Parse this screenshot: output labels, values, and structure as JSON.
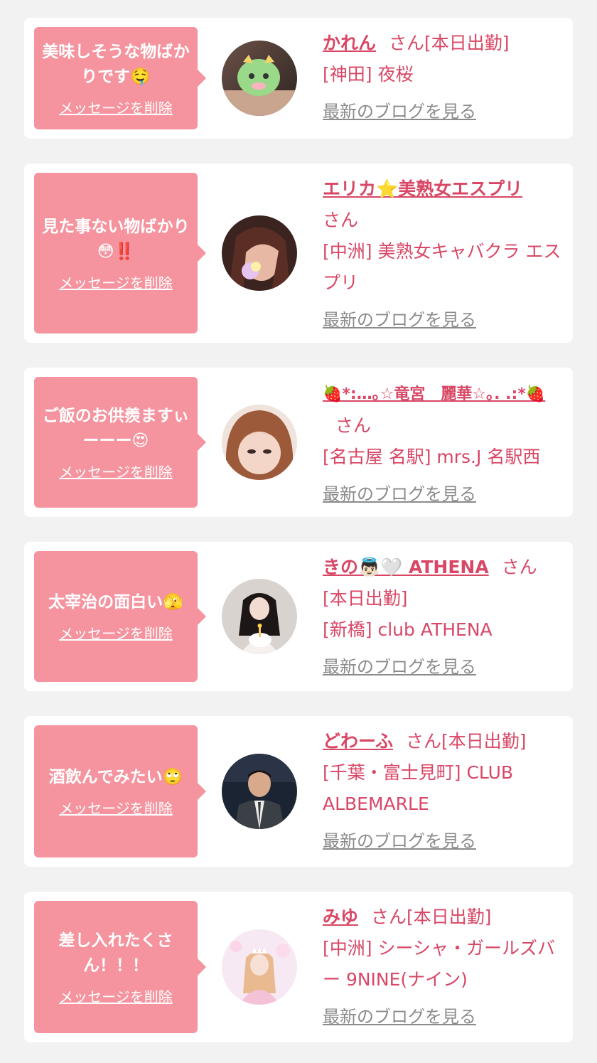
{
  "colors": {
    "bubble": "#f5949f",
    "accent_text": "#d84765",
    "muted_link": "#8b8b8b",
    "background": "#f2f2f3",
    "card": "#ffffff"
  },
  "common": {
    "delete_label": "メッセージを削除",
    "blog_label": "最新のブログを見る",
    "san_label": "さん"
  },
  "messages": [
    {
      "text": "美味しそうな物ばかりです🤤",
      "name": "かれん",
      "status": "[本日出勤]",
      "shop": "[神田] 夜桜"
    },
    {
      "text": "見た事ない物ばかり😳‼️",
      "name": "エリカ⭐美熟女エスプリ",
      "status": "",
      "shop": "[中洲] 美熟女キャバクラ エスプリ"
    },
    {
      "text": "ご飯のお供羨ますぃーーー😍",
      "name": "🍓*:…｡☆竜宮　麗華☆｡. .:*🍓",
      "status": "",
      "shop": "[名古屋 名駅] mrs.J 名駅西"
    },
    {
      "text": "太宰治の面白い🫣",
      "name": "きの👼🏻🤍 ATHENA",
      "status": "[本日出勤]",
      "shop": "[新橋] club ATHENA"
    },
    {
      "text": "酒飲んでみたい🙄",
      "name": "どわーふ",
      "status": "[本日出勤]",
      "shop": "[千葉・富士見町] CLUB ALBEMARLE"
    },
    {
      "text": "差し入れたくさん！！！",
      "name": "みゆ",
      "status": "[本日出勤]",
      "shop": "[中洲] シーシャ・ガールズバー 9NINE(ナイン)"
    }
  ]
}
